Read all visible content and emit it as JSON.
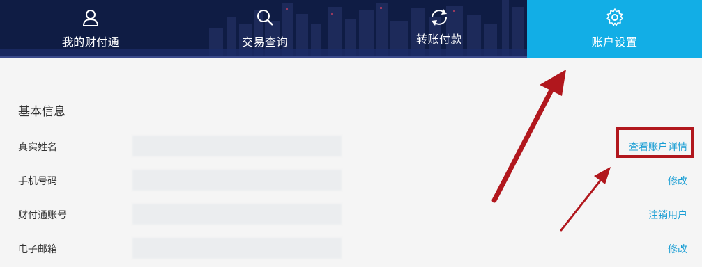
{
  "nav": {
    "items": [
      {
        "label": "我的财付通",
        "icon": "user-icon"
      },
      {
        "label": "交易查询",
        "icon": "search-icon"
      },
      {
        "label": "转账付款",
        "icon": "refresh-icon"
      },
      {
        "label": "账户设置",
        "icon": "gear-icon",
        "active": true
      }
    ],
    "active_color": "#12aee6"
  },
  "section": {
    "title": "基本信息",
    "rows": [
      {
        "label": "真实姓名",
        "action": "查看账户详情"
      },
      {
        "label": "手机号码",
        "action": "修改"
      },
      {
        "label": "财付通账号",
        "action": "注销用户"
      },
      {
        "label": "电子邮箱",
        "action": "修改"
      }
    ]
  },
  "colors": {
    "link": "#1a9ed4",
    "annotation": "#b1171d"
  }
}
